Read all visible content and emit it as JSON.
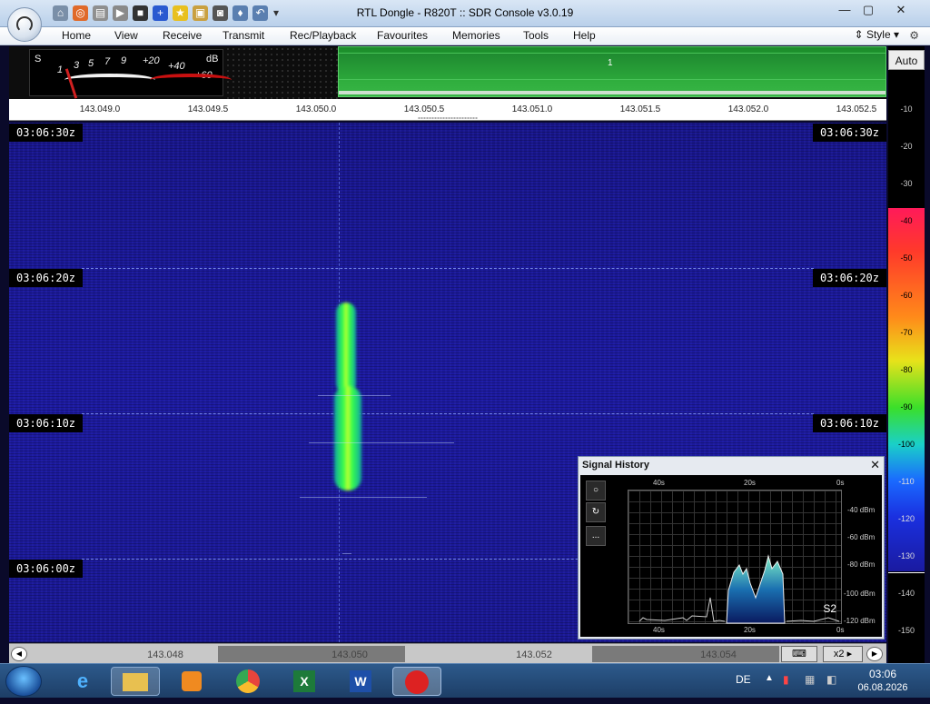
{
  "window": {
    "title": "RTL Dongle - R820T :: SDR Console v3.0.19",
    "minimize": "—",
    "maximize": "▢",
    "close": "✕"
  },
  "menu": {
    "items": [
      "Home",
      "View",
      "Receive",
      "Transmit",
      "Rec/Playback",
      "Favourites",
      "Memories",
      "Tools",
      "Help"
    ],
    "style_label": "Style"
  },
  "smeter": {
    "s_label": "S",
    "db_label": "dB",
    "scale": [
      "1",
      "3",
      "5",
      "7",
      "9",
      "+20",
      "+40",
      "+60"
    ]
  },
  "spectrum": {
    "channel_number": "1"
  },
  "ruler": {
    "labels": [
      "143.049.0",
      "143.049.5",
      "143.050.0",
      "143.050.5",
      "143.051.0",
      "143.051.5",
      "143.052.0",
      "143.052.5"
    ]
  },
  "waterfall": {
    "timestamps": [
      "03:06:30z",
      "03:06:20z",
      "03:06:10z",
      "03:06:00z"
    ]
  },
  "level_scale": {
    "auto_label": "Auto",
    "labels": [
      "-10",
      "-20",
      "-30",
      "-40",
      "-50",
      "-60",
      "-70",
      "-80",
      "-90",
      "-100",
      "-110",
      "-120",
      "-130",
      "-140",
      "-150"
    ]
  },
  "signal_history": {
    "title": "Signal History",
    "close": "✕",
    "top_time_labels": [
      "40s",
      "20s",
      "0s"
    ],
    "bottom_time_labels": [
      "40s",
      "20s",
      "0s"
    ],
    "db_labels": [
      "-40 dBm",
      "-60 dBm",
      "-80 dBm",
      "-100 dBm",
      "-120 dBm"
    ],
    "s_reading": "S2",
    "tool_more": "..."
  },
  "bottombar": {
    "freqs": [
      "143.048",
      "143.050",
      "143.052",
      "143.054"
    ],
    "zoom": "x2"
  },
  "taskbar": {
    "apps": [
      "internet-explorer",
      "file-explorer",
      "media-player",
      "chrome",
      "excel",
      "word",
      "sdr-console"
    ],
    "excel_letter": "X",
    "word_letter": "W",
    "language": "DE",
    "time": "03:06",
    "date": "06.08.2026"
  },
  "colors": {
    "waterfall_bg": "#1c1aa0",
    "signal_core": "#37ff4a",
    "spectrum_green": "#2aa838"
  }
}
